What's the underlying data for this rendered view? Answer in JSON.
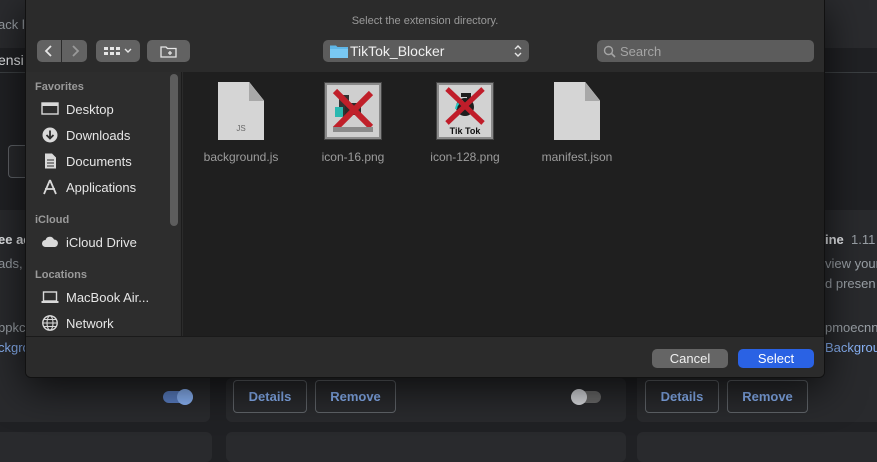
{
  "background": {
    "topbar_left": "ack l",
    "section_left": "ensi",
    "card_left": {
      "title": "ee ac",
      "line1": "ads,",
      "id": "bpkc",
      "link": "ckgrc"
    },
    "card_right": {
      "title": "ine",
      "version": "1.11",
      "line1": "view your",
      "line2": "d presen",
      "id": "pmoecnn",
      "link": "Background"
    },
    "details_label": "Details",
    "remove_label": "Remove"
  },
  "dialog": {
    "title": "Select the extension directory.",
    "current_folder": "TikTok_Blocker",
    "search_placeholder": "Search",
    "cancel_label": "Cancel",
    "select_label": "Select"
  },
  "sidebar": {
    "sections": [
      {
        "heading": "Favorites",
        "items": [
          {
            "label": "Desktop",
            "icon": "desktop-icon"
          },
          {
            "label": "Downloads",
            "icon": "downloads-icon"
          },
          {
            "label": "Documents",
            "icon": "documents-icon"
          },
          {
            "label": "Applications",
            "icon": "applications-icon"
          }
        ]
      },
      {
        "heading": "iCloud",
        "items": [
          {
            "label": "iCloud Drive",
            "icon": "cloud-icon"
          }
        ]
      },
      {
        "heading": "Locations",
        "items": [
          {
            "label": "MacBook Air...",
            "icon": "laptop-icon"
          },
          {
            "label": "Network",
            "icon": "network-icon"
          }
        ]
      }
    ]
  },
  "files": [
    {
      "name": "background.js",
      "type": "js",
      "badge": "JS"
    },
    {
      "name": "icon-16.png",
      "type": "png",
      "badge": ""
    },
    {
      "name": "icon-128.png",
      "type": "png",
      "badge": "Tik Tok"
    },
    {
      "name": "manifest.json",
      "type": "json",
      "badge": ""
    }
  ],
  "colors": {
    "accent": "#2a62e4",
    "link": "#8ab4f8",
    "toggle_on": "#8ab4f8"
  },
  "toggles": {
    "left_enabled": true,
    "right_enabled": false
  }
}
